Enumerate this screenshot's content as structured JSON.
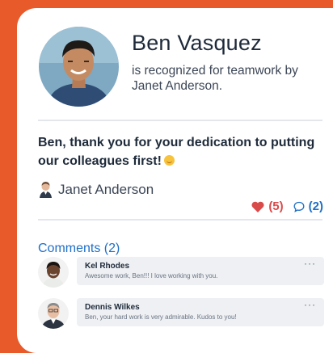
{
  "recipient": {
    "name": "Ben Vasquez",
    "recognition_text": "is recognized for teamwork by Janet Anderson."
  },
  "message": {
    "text": "Ben, thank you for your dedication to putting our colleagues first!",
    "emoji_icon": "smiling-face-emoji"
  },
  "author": {
    "name": "Janet Anderson"
  },
  "reactions": {
    "likes_label": "(5)",
    "comments_label": "(2)",
    "heart_color": "#d94a4a",
    "comment_color": "#1f6fc7"
  },
  "comments": {
    "title": "Comments (2)",
    "items": [
      {
        "author": "Kel Rhodes",
        "text": "Awesome work, Ben!!! I love working with you.",
        "more": "···"
      },
      {
        "author": "Dennis Wilkes",
        "text": "Ben, your hard work is very admirable. Kudos to you!",
        "more": "···"
      }
    ]
  },
  "colors": {
    "background": "#e85a2a",
    "card": "#ffffff",
    "accent": "#1f6fc7"
  }
}
